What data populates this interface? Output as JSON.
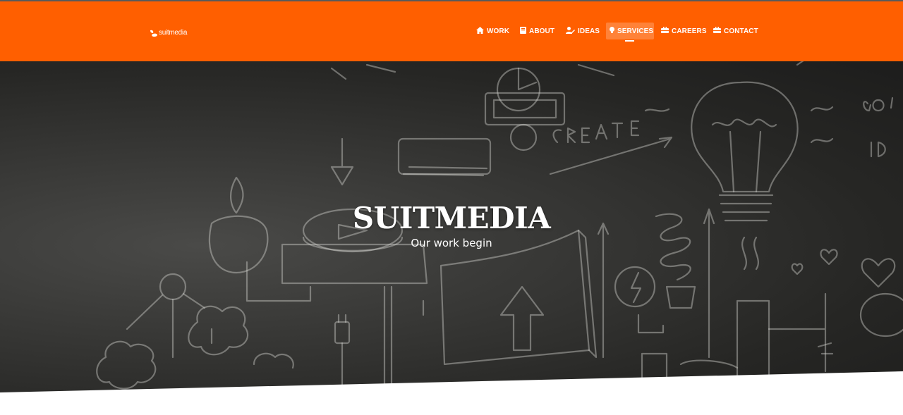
{
  "brand": {
    "logo_text": "suitmedia",
    "accent_color": "#ff5f00"
  },
  "nav": {
    "items": [
      {
        "label": "WORK",
        "icon": "home-icon"
      },
      {
        "label": "ABOUT",
        "icon": "book-icon"
      },
      {
        "label": "IDEAS",
        "icon": "user-edit-icon"
      },
      {
        "label": "SERVICES",
        "icon": "lightbulb-icon",
        "active": true
      },
      {
        "label": "CAREERS",
        "icon": "briefcase-icon"
      },
      {
        "label": "CONTACT",
        "icon": "briefcase-icon"
      }
    ]
  },
  "hero": {
    "title": "SUITMEDIA",
    "subtitle": "Our work begin"
  }
}
